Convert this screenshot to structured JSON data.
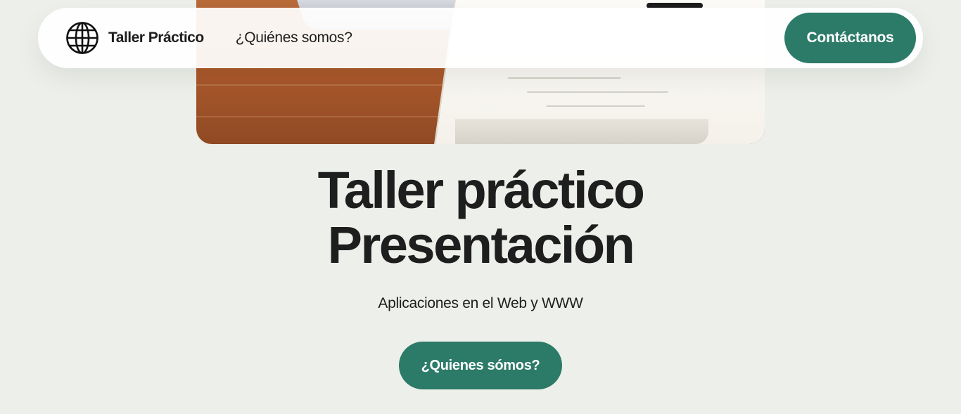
{
  "nav": {
    "brand": "Taller Práctico",
    "brand_icon": "globe-icon",
    "link": "¿Quiénes somos?",
    "cta": "Contáctanos"
  },
  "hero": {
    "image": "desk-photo",
    "title_line1": "Taller práctico",
    "title_line2": "Presentación",
    "subtitle": "Aplicaciones en el Web y WWW",
    "button": "¿Quienes sómos?"
  },
  "colors": {
    "background": "#edefea",
    "accent": "#2c7a68",
    "text": "#1e1e1e"
  }
}
